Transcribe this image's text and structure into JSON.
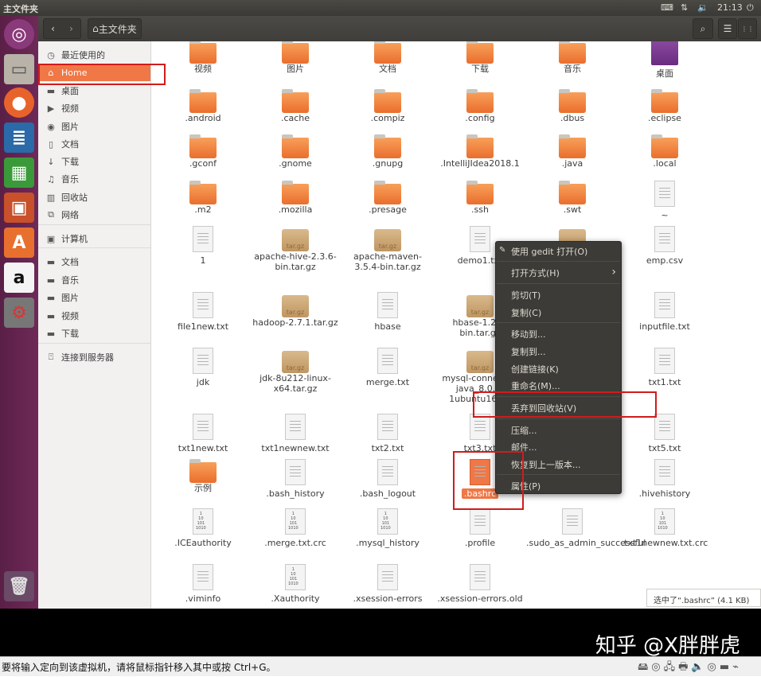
{
  "window_title": "主文件夹",
  "topbar": {
    "time": "21:13",
    "indicators": [
      "keyboard-icon",
      "network-icon",
      "volume-icon",
      "power-icon"
    ]
  },
  "launcher": [
    "ubuntu-dash-icon",
    "files-icon",
    "firefox-icon",
    "writer-icon",
    "calc-icon",
    "impress-icon",
    "software-center-icon",
    "amazon-icon",
    "settings-icon",
    "trash-icon"
  ],
  "toolbar": {
    "back": "‹",
    "forward": "›",
    "path": "主文件夹",
    "search": "⌕",
    "list_view": "☰",
    "grid_view": "⋮⋮"
  },
  "sidebar": {
    "items": [
      {
        "label": "最近使用的",
        "icon": "clock-icon"
      },
      {
        "label": "Home",
        "icon": "home-icon",
        "active": true
      },
      {
        "label": "桌面",
        "icon": "folder-icon"
      },
      {
        "label": "视频",
        "icon": "video-icon"
      },
      {
        "label": "图片",
        "icon": "camera-icon"
      },
      {
        "label": "文档",
        "icon": "document-icon"
      },
      {
        "label": "下载",
        "icon": "download-icon"
      },
      {
        "label": "音乐",
        "icon": "music-icon"
      },
      {
        "label": "回收站",
        "icon": "trash-icon"
      },
      {
        "label": "网络",
        "icon": "network-icon"
      },
      {
        "label": "计算机",
        "icon": "computer-icon"
      },
      {
        "label": "文档",
        "icon": "folder-icon"
      },
      {
        "label": "音乐",
        "icon": "folder-icon"
      },
      {
        "label": "图片",
        "icon": "folder-icon"
      },
      {
        "label": "视频",
        "icon": "folder-icon"
      },
      {
        "label": "下载",
        "icon": "folder-icon"
      },
      {
        "label": "连接到服务器",
        "icon": "server-icon"
      }
    ]
  },
  "files": [
    [
      {
        "n": "视频",
        "t": "folder"
      },
      {
        "n": "图片",
        "t": "folder"
      },
      {
        "n": "文档",
        "t": "folder"
      },
      {
        "n": "下载",
        "t": "folder"
      },
      {
        "n": "音乐",
        "t": "folder"
      },
      {
        "n": "桌面",
        "t": "desk"
      }
    ],
    [
      {
        "n": ".android",
        "t": "folder"
      },
      {
        "n": ".cache",
        "t": "folder"
      },
      {
        "n": ".compiz",
        "t": "folder"
      },
      {
        "n": ".config",
        "t": "folder"
      },
      {
        "n": ".dbus",
        "t": "folder"
      },
      {
        "n": ".eclipse",
        "t": "folder"
      }
    ],
    [
      {
        "n": ".gconf",
        "t": "folder"
      },
      {
        "n": ".gnome",
        "t": "folder"
      },
      {
        "n": ".gnupg",
        "t": "folder"
      },
      {
        "n": ".IntelliJIdea2018.1",
        "t": "folder"
      },
      {
        "n": ".java",
        "t": "folder"
      },
      {
        "n": ".local",
        "t": "folder"
      }
    ],
    [
      {
        "n": ".m2",
        "t": "folder"
      },
      {
        "n": ".mozilla",
        "t": "folder"
      },
      {
        "n": ".presage",
        "t": "folder"
      },
      {
        "n": ".ssh",
        "t": "folder"
      },
      {
        "n": ".swt",
        "t": "folder"
      },
      {
        "n": "~",
        "t": "doc"
      }
    ],
    [
      {
        "n": "1",
        "t": "doc"
      },
      {
        "n": "apache-hive-2.3.6-bin.tar.gz",
        "t": "arch"
      },
      {
        "n": "apache-maven-3.5.4-bin.tar.gz",
        "t": "arch"
      },
      {
        "n": "demo1.txt",
        "t": "doc"
      },
      {
        "n": "",
        "t": "arch"
      },
      {
        "n": "emp.csv",
        "t": "doc"
      }
    ],
    [
      {
        "n": "file1new.txt",
        "t": "doc"
      },
      {
        "n": "hadoop-2.7.1.tar.gz",
        "t": "arch"
      },
      {
        "n": "hbase",
        "t": "doc"
      },
      {
        "n": "hbase-1.2.6-bin.tar.gz",
        "t": "arch"
      },
      {
        "n": "",
        "t": "none"
      },
      {
        "n": "inputfile.txt",
        "t": "doc"
      }
    ],
    [
      {
        "n": "jdk",
        "t": "doc"
      },
      {
        "n": "jdk-8u212-linux-x64.tar.gz",
        "t": "arch"
      },
      {
        "n": "merge.txt",
        "t": "doc"
      },
      {
        "n": "mysql-connector-java_8.0.2-1ubuntu16.04",
        "t": "arch"
      },
      {
        "n": "",
        "t": "none"
      },
      {
        "n": "txt1.txt",
        "t": "doc"
      }
    ],
    [
      {
        "n": "txt1new.txt",
        "t": "doc"
      },
      {
        "n": "txt1newnew.txt",
        "t": "doc"
      },
      {
        "n": "txt2.txt",
        "t": "doc"
      },
      {
        "n": "txt3.txt",
        "t": "doc"
      },
      {
        "n": "",
        "t": "none"
      },
      {
        "n": "txt5.txt",
        "t": "doc"
      }
    ],
    [
      {
        "n": "示例",
        "t": "folder"
      },
      {
        "n": ".bash_history",
        "t": "doc"
      },
      {
        "n": ".bash_logout",
        "t": "doc"
      },
      {
        "n": ".bashrc",
        "t": "doc",
        "selected": true
      },
      {
        "n": "",
        "t": "none"
      },
      {
        "n": ".hivehistory",
        "t": "doc"
      }
    ],
    [
      {
        "n": ".ICEauthority",
        "t": "bin"
      },
      {
        "n": ".merge.txt.crc",
        "t": "bin"
      },
      {
        "n": ".mysql_history",
        "t": "bin"
      },
      {
        "n": ".profile",
        "t": "doc"
      },
      {
        "n": ".sudo_as_admin_successful",
        "t": "doc"
      },
      {
        "n": ".txt1newnew.txt.crc",
        "t": "bin"
      }
    ],
    [
      {
        "n": ".viminfo",
        "t": "doc"
      },
      {
        "n": ".Xauthority",
        "t": "bin"
      },
      {
        "n": ".xsession-errors",
        "t": "doc"
      },
      {
        "n": ".xsession-errors.old",
        "t": "doc"
      }
    ]
  ],
  "context_menu": [
    [
      "使用 gedit 打开(O)"
    ],
    [
      "打开方式(H)"
    ],
    [
      "剪切(T)",
      "复制(C)"
    ],
    [
      "移动到...",
      "复制到...",
      "创建链接(K)",
      "重命名(M)..."
    ],
    [
      "丢弃到回收站(V)"
    ],
    [
      "压缩...",
      "邮件...",
      "恢复到上一版本..."
    ],
    [
      "属性(P)"
    ]
  ],
  "status": "选中了“.bashrc” (4.1 KB)",
  "watermark": "知乎 @X胖胖虎",
  "vm_hint": "要将输入定向到该虚拟机，请将鼠标指针移入其中或按 Ctrl+G。",
  "vm_icons": "🖴◎🖧🖶🔈◎▬⌁"
}
